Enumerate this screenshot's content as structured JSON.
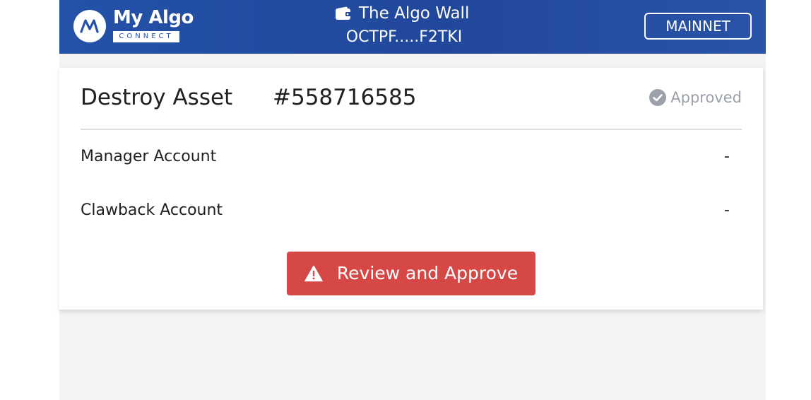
{
  "header": {
    "brand_name": "My Algo",
    "brand_sub": "CONNECT",
    "wallet_name": "The Algo Wall",
    "wallet_address": "OCTPF.....F2TKI",
    "network_label": "MAINNET"
  },
  "transaction": {
    "title": "Destroy Asset",
    "asset_id": "#558716585",
    "status": "Approved",
    "rows": [
      {
        "label": "Manager Account",
        "value": "-"
      },
      {
        "label": "Clawback Account",
        "value": "-"
      }
    ],
    "approve_label": "Review and Approve"
  },
  "colors": {
    "header_blue": "#2352a8",
    "approve_red": "#d64845",
    "status_gray": "#9ba0aa"
  },
  "icons": {
    "logo": "myalgo-logo-icon",
    "wallet": "wallet-icon",
    "status": "check-circle-icon",
    "warning": "warning-triangle-icon"
  }
}
